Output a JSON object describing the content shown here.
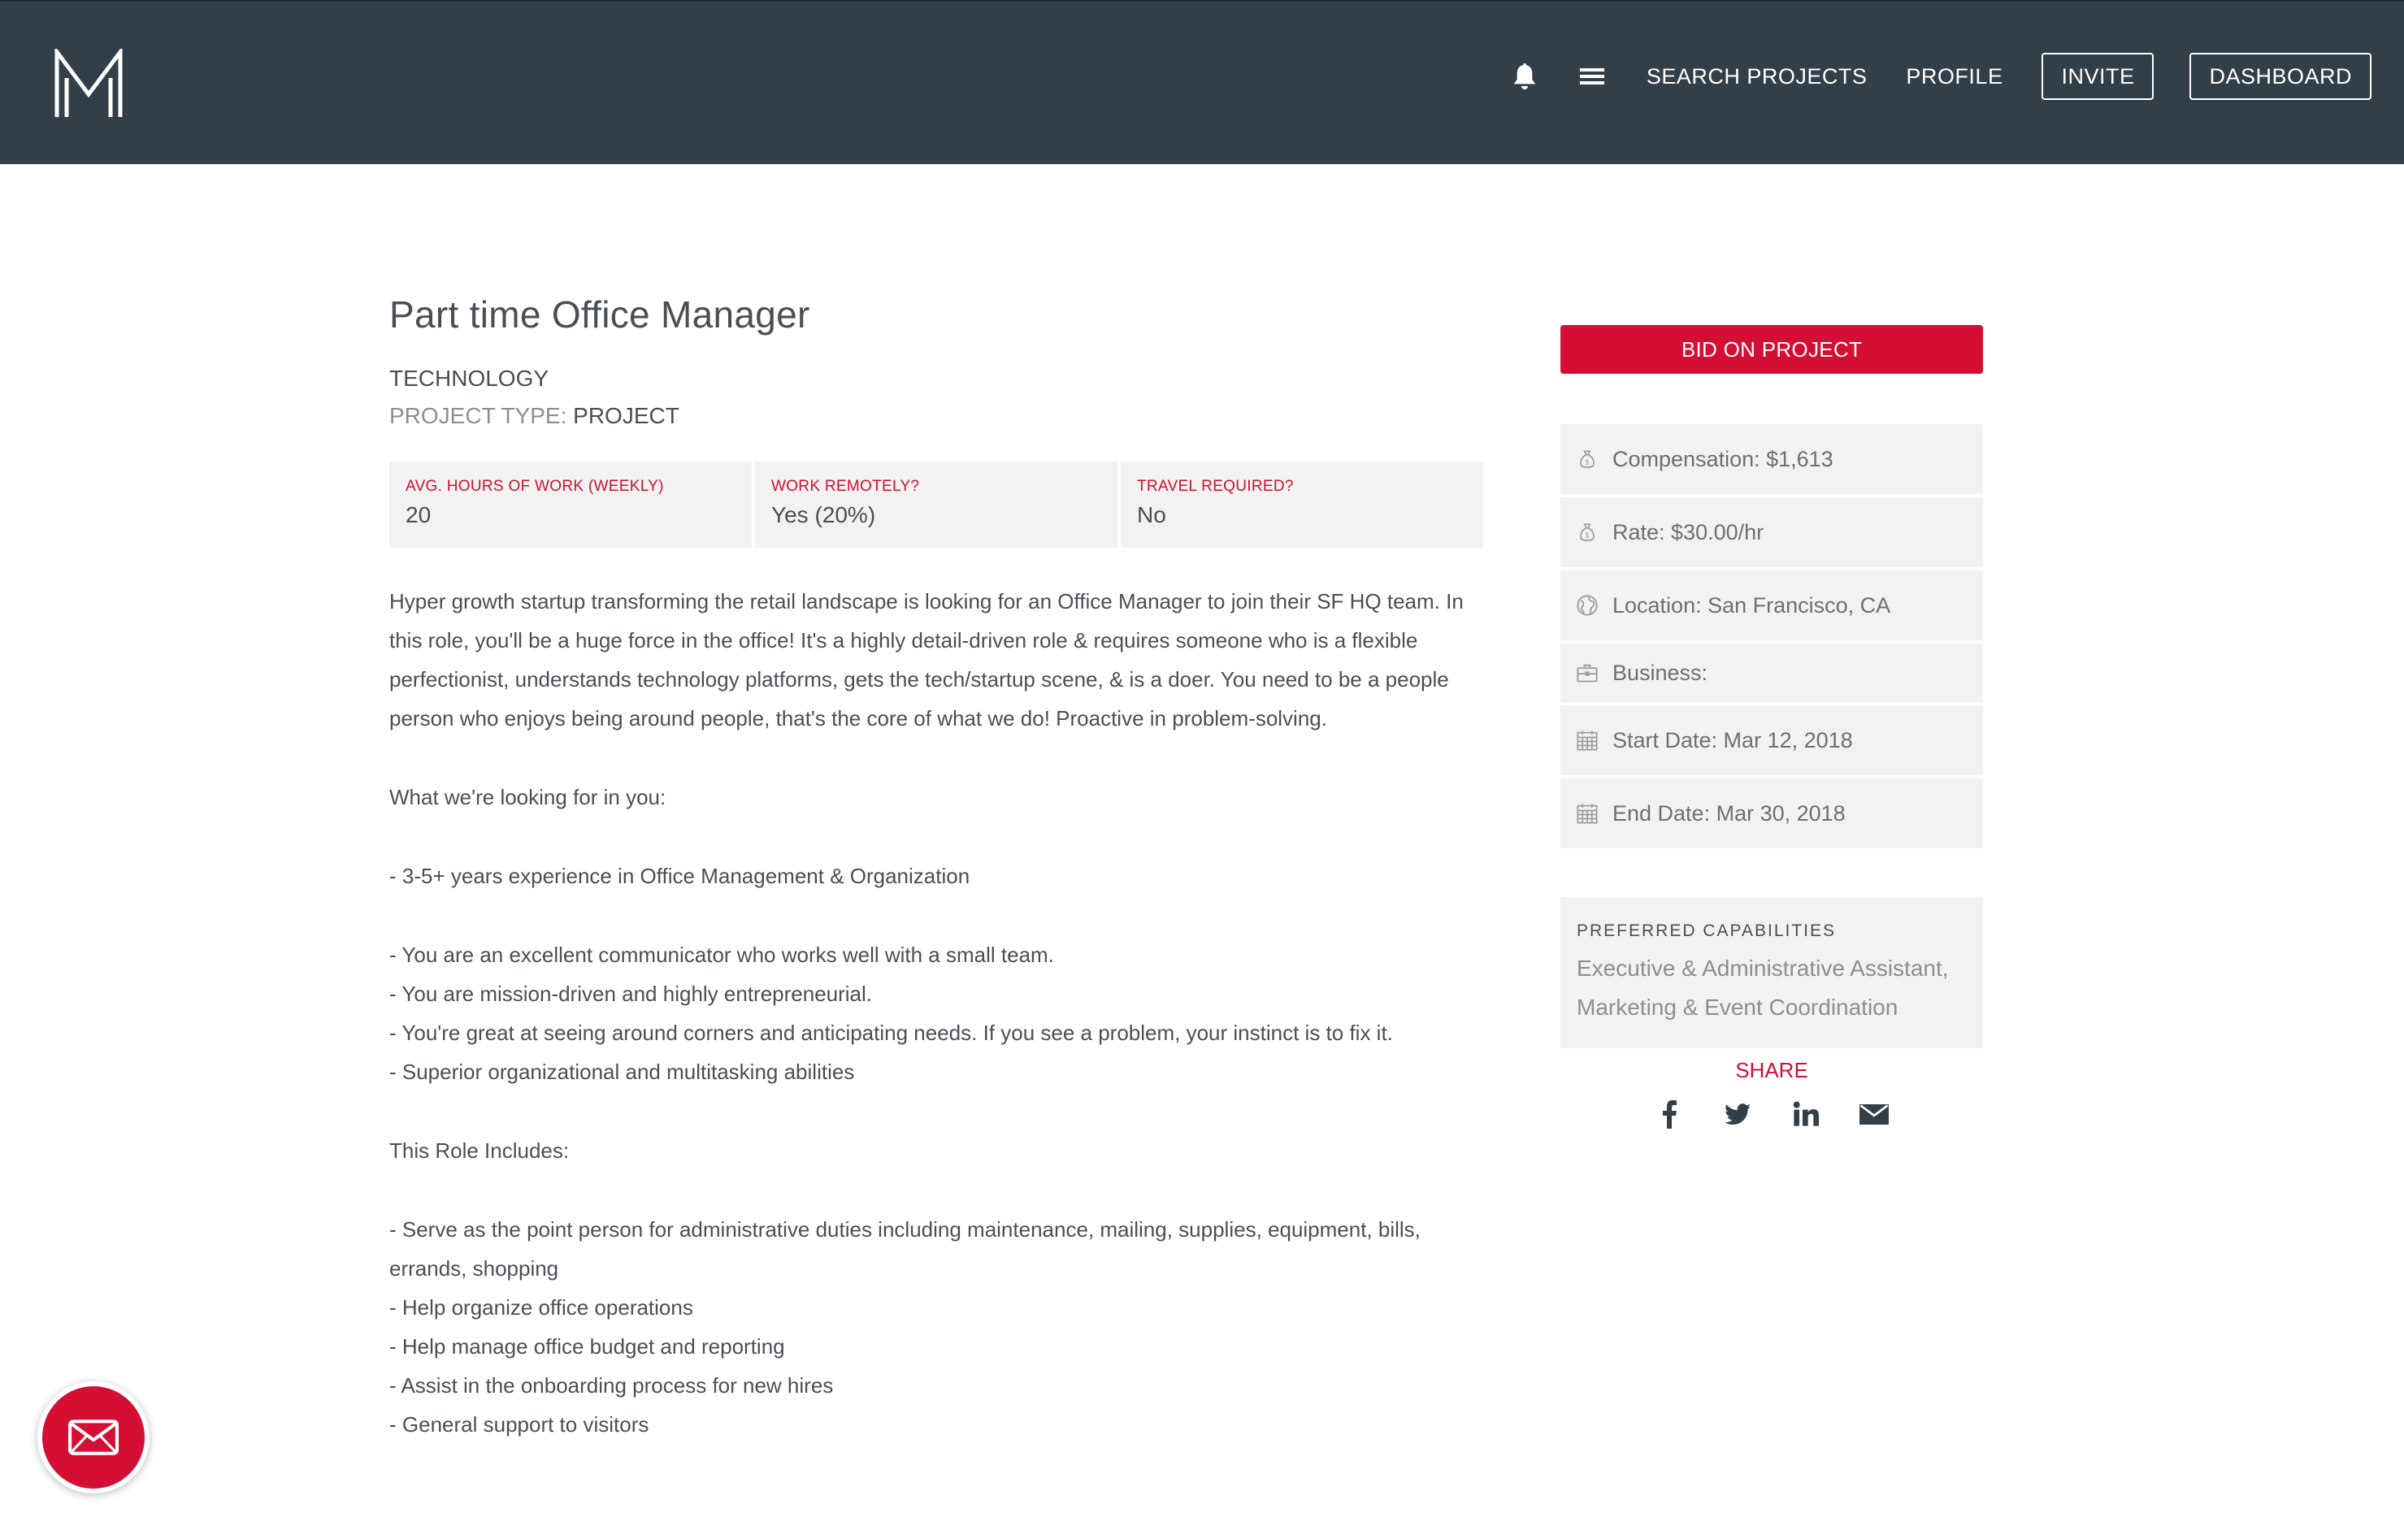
{
  "header": {
    "logo_icon": "monogram-m-logo",
    "bell_icon": "bell-icon",
    "menu_icon": "hamburger-menu-icon",
    "links": {
      "search": "SEARCH PROJECTS",
      "profile": "PROFILE"
    },
    "buttons": {
      "invite": "INVITE",
      "dashboard": "DASHBOARD"
    },
    "background_color": "#333f48"
  },
  "project": {
    "title": "Part time Office Manager",
    "category": "TECHNOLOGY",
    "type_label": "PROJECT TYPE:",
    "type_value": "PROJECT",
    "stats": [
      {
        "label": "AVG. HOURS OF WORK (WEEKLY)",
        "value": "20"
      },
      {
        "label": "WORK REMOTELY?",
        "value": "Yes (20%)"
      },
      {
        "label": "TRAVEL REQUIRED?",
        "value": "No"
      }
    ],
    "description": {
      "intro": "Hyper growth startup transforming the retail landscape is looking for an Office Manager to join their SF HQ team. In this role, you'll be a huge force in the office! It's a highly detail-driven role & requires someone who is a flexible perfectionist, understands technology platforms, gets the tech/startup scene, & is a doer. You need to be a people person who enjoys being around people, that's the core of what we do! Proactive in problem-solving.",
      "looking_for_heading": "What we're looking for in you:",
      "experience": "- 3-5+ years experience in Office Management & Organization",
      "traits": [
        "- You are an excellent communicator who works well with a small team.",
        "- You are mission-driven and highly entrepreneurial.",
        "- You're great at seeing around corners and anticipating needs. If you see a problem, your instinct is to fix it.",
        "- Superior organizational and multitasking abilities"
      ],
      "role_heading": "This Role Includes:",
      "role_items": [
        "- Serve as the point person for administrative duties including maintenance, mailing, supplies, equipment, bills, errands, shopping",
        "- Help organize office operations",
        "- Help manage office budget and reporting",
        "- Assist in the onboarding process for new hires",
        "- General support to visitors"
      ]
    }
  },
  "sidebar": {
    "bid_button": "BID ON PROJECT",
    "info": [
      {
        "icon": "money-bag-icon",
        "text": "Compensation: $1,613"
      },
      {
        "icon": "money-bag-icon",
        "text": "Rate: $30.00/hr"
      },
      {
        "icon": "globe-icon",
        "text": "Location: San Francisco, CA"
      },
      {
        "icon": "briefcase-icon",
        "text": "Business:"
      },
      {
        "icon": "calendar-icon",
        "text": "Start Date: Mar 12, 2018"
      },
      {
        "icon": "calendar-icon",
        "text": "End Date: Mar 30, 2018"
      }
    ],
    "capabilities": {
      "title": "PREFERRED CAPABILITIES",
      "line1": "Executive & Administrative Assistant,",
      "line2": "Marketing & Event Coordination"
    },
    "share": {
      "label": "SHARE",
      "icons": [
        "facebook-icon",
        "twitter-icon",
        "linkedin-icon",
        "email-icon"
      ]
    },
    "accent_color": "#d50f33"
  },
  "floating_button": {
    "icon": "envelope-icon"
  }
}
